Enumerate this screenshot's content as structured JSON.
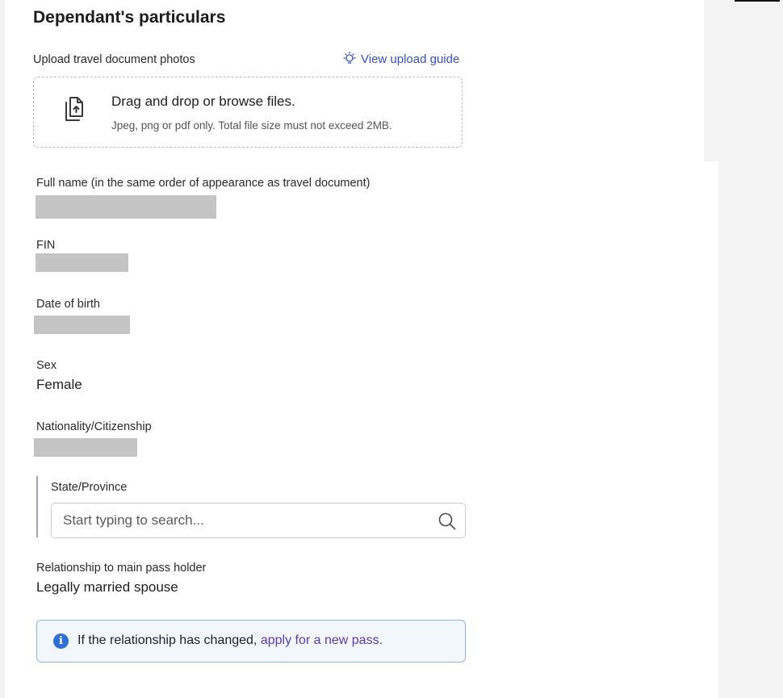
{
  "section": {
    "title": "Dependant's particulars"
  },
  "upload": {
    "label": "Upload travel document photos",
    "guide_link": "View upload guide",
    "dropzone_title": "Drag and drop or browse files.",
    "dropzone_hint": "Jpeg, png or pdf only. Total file size must not exceed 2MB.",
    "icon": "file-upload-icon",
    "guide_icon": "lightbulb-icon"
  },
  "fields": {
    "full_name": {
      "label": "Full name (in the same order of appearance as travel document)"
    },
    "fin": {
      "label": "FIN"
    },
    "dob": {
      "label": "Date of birth"
    },
    "sex": {
      "label": "Sex",
      "value": "Female"
    },
    "nationality": {
      "label": "Nationality/Citizenship"
    },
    "state": {
      "label": "State/Province",
      "placeholder": "Start typing to search...",
      "icon": "search-icon"
    },
    "relationship": {
      "label": "Relationship to main pass holder",
      "value": "Legally married spouse"
    }
  },
  "notice": {
    "icon": "info-icon",
    "text": "If the relationship has changed, ",
    "link": "apply for a new pass."
  },
  "colors": {
    "link": "#3a4fc2",
    "notice_link": "#5b3bb0",
    "info_icon": "#2f6fd6",
    "notice_background": "#f2f7fe",
    "notice_border": "#8eb7e6"
  }
}
